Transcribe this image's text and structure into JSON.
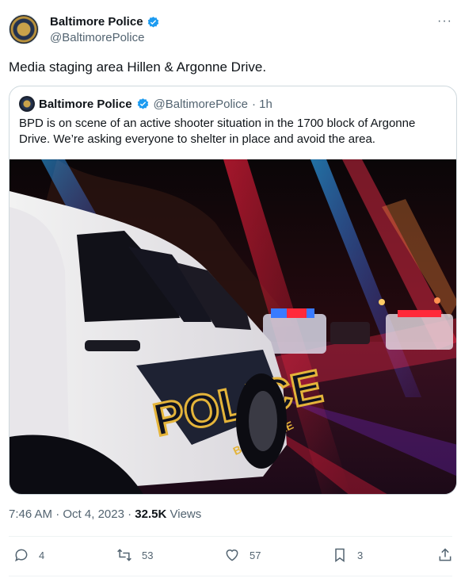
{
  "author": {
    "name": "Baltimore Police",
    "handle": "@BaltimorePolice",
    "avatar_icon": "police-badge"
  },
  "tweet": {
    "text": "Media staging area Hillen & Argonne Drive.",
    "time": "7:46 AM",
    "sep": "·",
    "date": "Oct 4, 2023",
    "views_count": "32.5K",
    "views_label": "Views"
  },
  "quoted": {
    "name": "Baltimore Police",
    "handle": "@BaltimorePolice",
    "age": "· 1h",
    "text": "BPD is on scene of an active shooter situation in the 1700 block of Argonne Drive. We’re asking everyone to shelter in place and avoid the area.",
    "photo": {
      "description_icon": "police-car-photo",
      "vehicle_text": "POLICE",
      "vehicle_subtext": "BALTIMORE"
    }
  },
  "actions": {
    "replies": "4",
    "retweets": "53",
    "likes": "57",
    "bookmarks": "3"
  },
  "colors": {
    "verified": "#1d9bf0",
    "text": "#0f1419",
    "muted": "#536471",
    "border": "#cfd9de"
  }
}
